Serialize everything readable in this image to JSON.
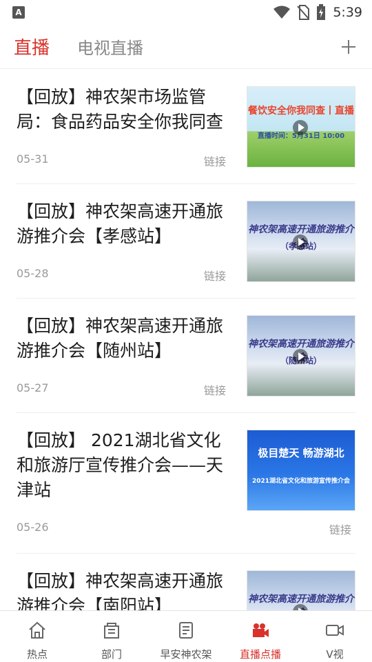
{
  "status_bar": {
    "time": "5:39"
  },
  "top_tabs": {
    "active": "直播",
    "inactive": "电视直播"
  },
  "items": [
    {
      "title": "【回放】神农架市场监管局：食品药品安全你我同查",
      "date": "05-31",
      "link": "链接",
      "thumb": {
        "line1": "餐饮安全你我同查丨直播",
        "line2": "直播时间：5月31日 10:00"
      }
    },
    {
      "title": "【回放】神农架高速开通旅游推介会【孝感站】",
      "date": "05-28",
      "link": "链接",
      "thumb": {
        "line1": "神农架高速开通旅游推介会",
        "line2": "（孝感站）"
      }
    },
    {
      "title": "【回放】神农架高速开通旅游推介会【随州站】",
      "date": "05-27",
      "link": "链接",
      "thumb": {
        "line1": "神农架高速开通旅游推介会",
        "line2": "（随州站）"
      }
    },
    {
      "title": "【回放】 2021湖北省文化和旅游厅宣传推介会——天津站",
      "date": "05-26",
      "link": "链接",
      "thumb": {
        "line1": "极目楚天 畅游湖北",
        "line2": "2021湖北省文化和旅游宣传推介会"
      }
    },
    {
      "title": "【回放】神农架高速开通旅游推介会【南阳站】",
      "date": "",
      "link": "",
      "thumb": {
        "line1": "神农架高速开通旅游推介会",
        "line2": ""
      }
    }
  ],
  "bottom_nav": [
    {
      "label": "热点",
      "icon": "home-icon"
    },
    {
      "label": "部门",
      "icon": "building-icon"
    },
    {
      "label": "早安神农架",
      "icon": "document-icon"
    },
    {
      "label": "直播点播",
      "icon": "video-camera-icon"
    },
    {
      "label": "V视",
      "icon": "video-icon"
    }
  ],
  "colors": {
    "accent": "#d8322b"
  }
}
